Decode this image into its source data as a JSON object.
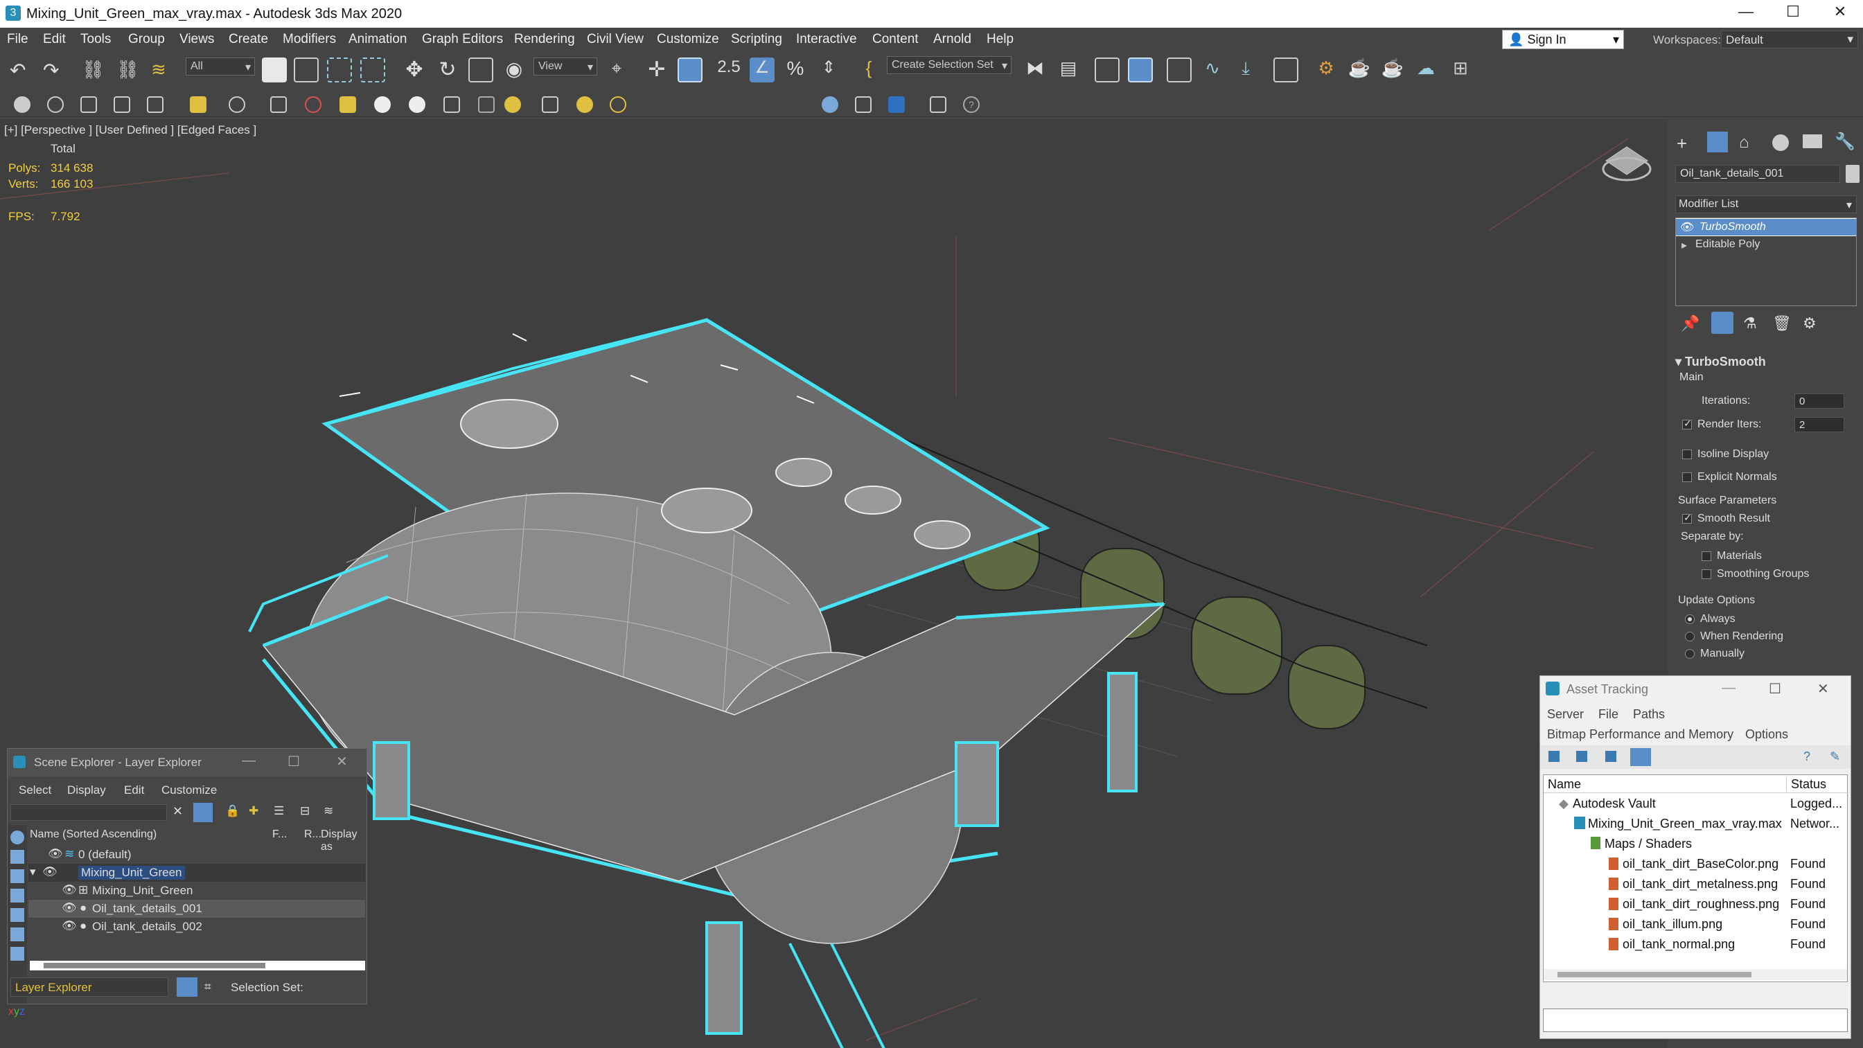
{
  "window": {
    "title": "Mixing_Unit_Green_max_vray.max - Autodesk 3ds Max 2020"
  },
  "menu": [
    "File",
    "Edit",
    "Tools",
    "Group",
    "Views",
    "Create",
    "Modifiers",
    "Animation",
    "Graph Editors",
    "Rendering",
    "Civil View",
    "Customize",
    "Scripting",
    "Interactive",
    "Content",
    "Arnold",
    "Help"
  ],
  "signin": {
    "label": "Sign In",
    "workspaces_label": "Workspaces:",
    "workspace": "Default"
  },
  "toolbar": {
    "filter": "All",
    "view": "View",
    "selection_set": "Create Selection Set",
    "snap_value": "2.5"
  },
  "viewport": {
    "label": "[+] [Perspective ] [User Defined ] [Edged Faces ]",
    "stats": {
      "total_label": "Total",
      "polys_label": "Polys:",
      "polys": "314 638",
      "verts_label": "Verts:",
      "verts": "166 103",
      "fps_label": "FPS:",
      "fps": "7.792"
    }
  },
  "command_panel": {
    "object_name": "Oil_tank_details_001",
    "modifier_list": "Modifier List",
    "stack": [
      "TurboSmooth",
      "Editable Poly"
    ],
    "rollout": "TurboSmooth",
    "main": "Main",
    "iterations_label": "Iterations:",
    "iterations": "0",
    "render_iters_label": "Render Iters:",
    "render_iters": "2",
    "isoline": "Isoline Display",
    "explicit": "Explicit Normals",
    "surface": "Surface Parameters",
    "smooth_result": "Smooth Result",
    "separate": "Separate by:",
    "materials": "Materials",
    "smoothing_groups": "Smoothing Groups",
    "update": "Update Options",
    "always": "Always",
    "when_rendering": "When Rendering",
    "manually": "Manually"
  },
  "scene_explorer": {
    "title": "Scene Explorer - Layer Explorer",
    "menu": [
      "Select",
      "Display",
      "Edit",
      "Customize"
    ],
    "columns": {
      "name": "Name (Sorted Ascending)",
      "f": "F...",
      "r": "R...",
      "display": "Display as"
    },
    "rows": [
      "0 (default)",
      "Mixing_Unit_Green",
      "Mixing_Unit_Green",
      "Oil_tank_details_001",
      "Oil_tank_details_002"
    ],
    "footer_dropdown": "Layer Explorer",
    "selection_set": "Selection Set:"
  },
  "asset_tracking": {
    "title": "Asset Tracking",
    "menu1": [
      "Server",
      "File",
      "Paths"
    ],
    "menu2": [
      "Bitmap Performance and Memory",
      "Options"
    ],
    "columns": {
      "name": "Name",
      "status": "Status"
    },
    "rows": [
      {
        "name": "Autodesk Vault",
        "status": "Logged..."
      },
      {
        "name": "Mixing_Unit_Green_max_vray.max",
        "status": "Networ..."
      },
      {
        "name": "Maps / Shaders",
        "status": ""
      },
      {
        "name": "oil_tank_dirt_BaseColor.png",
        "status": "Found"
      },
      {
        "name": "oil_tank_dirt_metalness.png",
        "status": "Found"
      },
      {
        "name": "oil_tank_dirt_roughness.png",
        "status": "Found"
      },
      {
        "name": "oil_tank_illum.png",
        "status": "Found"
      },
      {
        "name": "oil_tank_normal.png",
        "status": "Found"
      }
    ]
  }
}
